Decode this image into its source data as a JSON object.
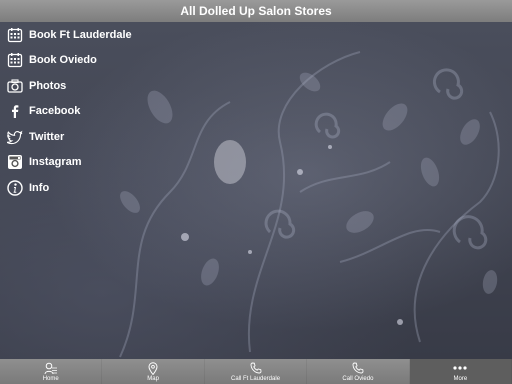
{
  "header": {
    "title": "All Dolled Up Salon Stores"
  },
  "menu": {
    "items": [
      {
        "label": "Book Ft Lauderdale",
        "icon": "calendar-icon"
      },
      {
        "label": "Book Oviedo",
        "icon": "calendar-icon"
      },
      {
        "label": "Photos",
        "icon": "camera-icon"
      },
      {
        "label": "Facebook",
        "icon": "facebook-icon"
      },
      {
        "label": "Twitter",
        "icon": "twitter-icon"
      },
      {
        "label": "Instagram",
        "icon": "instagram-icon"
      },
      {
        "label": "Info",
        "icon": "info-icon"
      }
    ]
  },
  "tabbar": {
    "tabs": [
      {
        "label": "Home",
        "icon": "home-icon",
        "active": false
      },
      {
        "label": "Map",
        "icon": "map-pin-icon",
        "active": false
      },
      {
        "label": "Call Ft Lauderdale",
        "icon": "phone-icon",
        "active": false
      },
      {
        "label": "Call Oviedo",
        "icon": "phone-icon",
        "active": false
      },
      {
        "label": "More",
        "icon": "more-dots-icon",
        "active": true
      }
    ]
  },
  "colors": {
    "header_bg": "#8c8c8c",
    "tabbar_bg": "#858585",
    "tab_active_bg": "#5e5e5e",
    "background": "#3b3f4c",
    "text": "#ffffff"
  }
}
